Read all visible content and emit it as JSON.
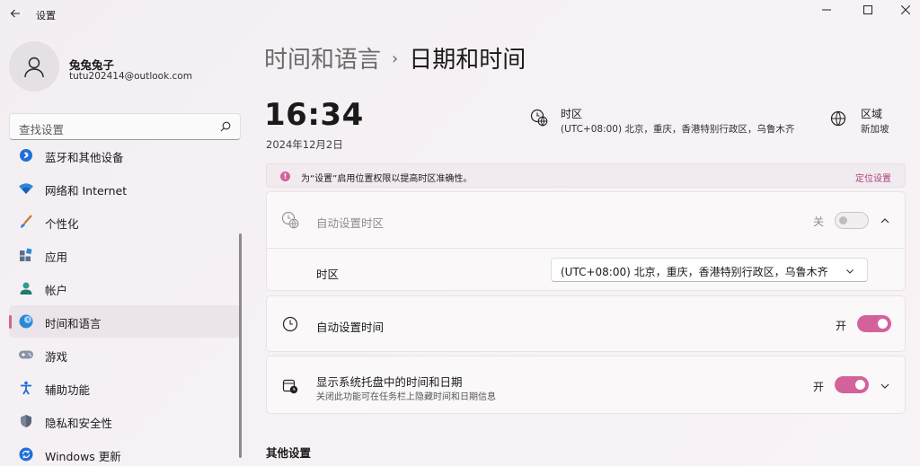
{
  "app": {
    "title": "设置"
  },
  "profile": {
    "name": "兔兔兔子",
    "email": "tutu202414@outlook.com"
  },
  "search": {
    "placeholder": "查找设置"
  },
  "nav": {
    "items": [
      {
        "label": "蓝牙和其他设备",
        "icon": "bluetooth-icon"
      },
      {
        "label": "网络和 Internet",
        "icon": "network-icon"
      },
      {
        "label": "个性化",
        "icon": "brush-icon"
      },
      {
        "label": "应用",
        "icon": "apps-icon"
      },
      {
        "label": "帐户",
        "icon": "account-icon"
      },
      {
        "label": "时间和语言",
        "icon": "time-language-icon",
        "active": true
      },
      {
        "label": "游戏",
        "icon": "gaming-icon"
      },
      {
        "label": "辅助功能",
        "icon": "accessibility-icon"
      },
      {
        "label": "隐私和安全性",
        "icon": "shield-icon"
      },
      {
        "label": "Windows 更新",
        "icon": "update-icon"
      }
    ]
  },
  "breadcrumb": {
    "parent": "时间和语言",
    "separator": "›",
    "current": "日期和时间"
  },
  "clock": {
    "time": "16:34",
    "date": "2024年12月2日"
  },
  "timezone_summary": {
    "title": "时区",
    "value": "(UTC+08:00) 北京，重庆，香港特别行政区，乌鲁木齐"
  },
  "region_summary": {
    "title": "区域",
    "value": "新加坡"
  },
  "banner": {
    "text": "为“设置”启用位置权限以提高时区准确性。",
    "link": "定位设置",
    "icon": "info-icon"
  },
  "auto_timezone": {
    "title": "自动设置时区",
    "state": "关"
  },
  "timezone_row": {
    "label": "时区",
    "selected": "(UTC+08:00) 北京，重庆，香港特别行政区，乌鲁木齐"
  },
  "auto_time": {
    "title": "自动设置时间",
    "state": "开"
  },
  "tray_time": {
    "title": "显示系统托盘中的时间和日期",
    "subtitle": "关闭此功能可在任务栏上隐藏时间和日期信息",
    "state": "开"
  },
  "other": {
    "title": "其他设置"
  },
  "colors": {
    "accent": "#d4629a",
    "background": "#f5f0f4",
    "card": "#faf8f9"
  }
}
